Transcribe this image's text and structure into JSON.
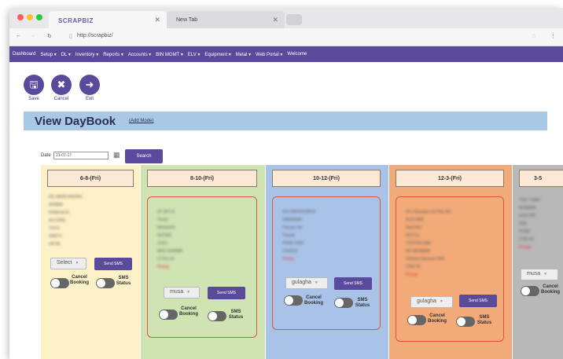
{
  "browser": {
    "tabs": [
      {
        "label": "SCRAPBIZ"
      },
      {
        "label": "New Tab"
      }
    ],
    "url": "http://scrapbiz/"
  },
  "menu": {
    "items": [
      "Dashboard",
      "Setup ▾",
      "DL ▾",
      "Inventory ▾",
      "Reports ▾",
      "Accounts ▾",
      "BIN MGMT ▾",
      "ELV ▾",
      "Equipment ▾",
      "Metal ▾",
      "Web Portal ▾",
      "Welcome"
    ]
  },
  "toolbar": {
    "buttons": [
      {
        "label": "Save",
        "icon": "save-icon"
      },
      {
        "label": "Cancel",
        "icon": "cancel-icon"
      },
      {
        "label": "Exit",
        "icon": "exit-icon"
      }
    ]
  },
  "page": {
    "title": "View DayBook",
    "add_link": "(Add Mode)"
  },
  "filter": {
    "date_label": "Date",
    "date_value": "21-07-17",
    "search_label": "Search"
  },
  "colors": {
    "accent": "#5a4a9c",
    "card_border": "#e0553a"
  },
  "columns": [
    {
      "header": "6-8-(Fri)",
      "color": "#fdf1c8",
      "select": "Select",
      "sms_label": "Send SMS",
      "toggle1": "Cancel Booking",
      "toggle2": "SMS Status"
    },
    {
      "header": "8-10-(Fri)",
      "color": "#cfe3b3",
      "select": "musa",
      "sms_label": "Send SMS",
      "toggle1": "Cancel Booking",
      "toggle2": "SMS Status"
    },
    {
      "header": "10-12-(Fri)",
      "color": "#a9c3e8",
      "select": "gulagha",
      "sms_label": "Send SMS",
      "toggle1": "Cancel Booking",
      "toggle2": "SMS Status"
    },
    {
      "header": "12-3-(Fri)",
      "color": "#f2aa78",
      "select": "gulagha",
      "sms_label": "Send SMS",
      "toggle1": "Cancel Booking",
      "toggle2": "SMS Status"
    },
    {
      "header": "3-5",
      "color": "#b8b8b8",
      "select": "musa",
      "sms_label": "",
      "toggle1": "Cancel Booking",
      "toggle2": ""
    }
  ]
}
